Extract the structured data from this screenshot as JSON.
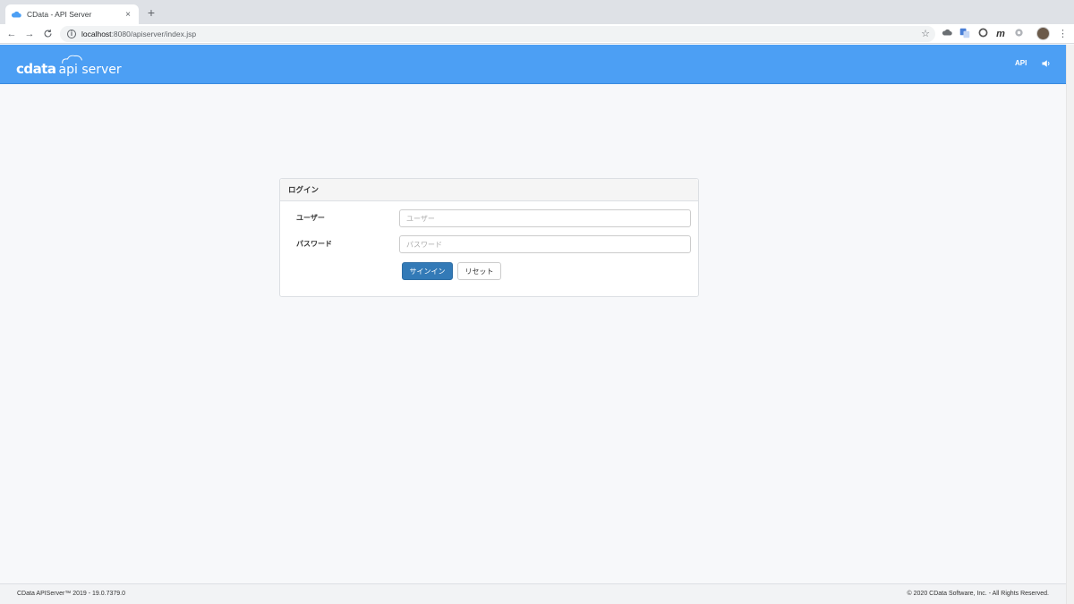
{
  "browser": {
    "tab": {
      "title": "CData - API Server",
      "close_glyph": "×"
    },
    "new_tab_glyph": "+",
    "nav": {
      "back_glyph": "←",
      "forward_glyph": "→",
      "reload_glyph": "C"
    },
    "address": {
      "host": "localhost",
      "rest": ":8080/apiserver/index.jsp"
    },
    "bookmark_glyph": "☆",
    "menu_glyph": "⋮",
    "extensions": [
      "cloud-extension-icon",
      "translate-extension-icon",
      "circle-extension-icon",
      "m-extension-icon",
      "gear-extension-icon"
    ],
    "m_extension_glyph": "m"
  },
  "header": {
    "brand": "cdata",
    "product": "api server",
    "api_link": "API",
    "bg_color": "#4c9ff4"
  },
  "login": {
    "title": "ログイン",
    "user_label": "ユーザー",
    "user_placeholder": "ユーザー",
    "user_value": "",
    "password_label": "パスワード",
    "password_placeholder": "パスワード",
    "password_value": "",
    "signin_label": "サインイン",
    "reset_label": "リセット",
    "primary_color": "#337ab7"
  },
  "footer": {
    "version": "CData APIServer™ 2019 - 19.0.7379.0",
    "copyright": "© 2020 CData Software, Inc. - All Rights Reserved."
  }
}
